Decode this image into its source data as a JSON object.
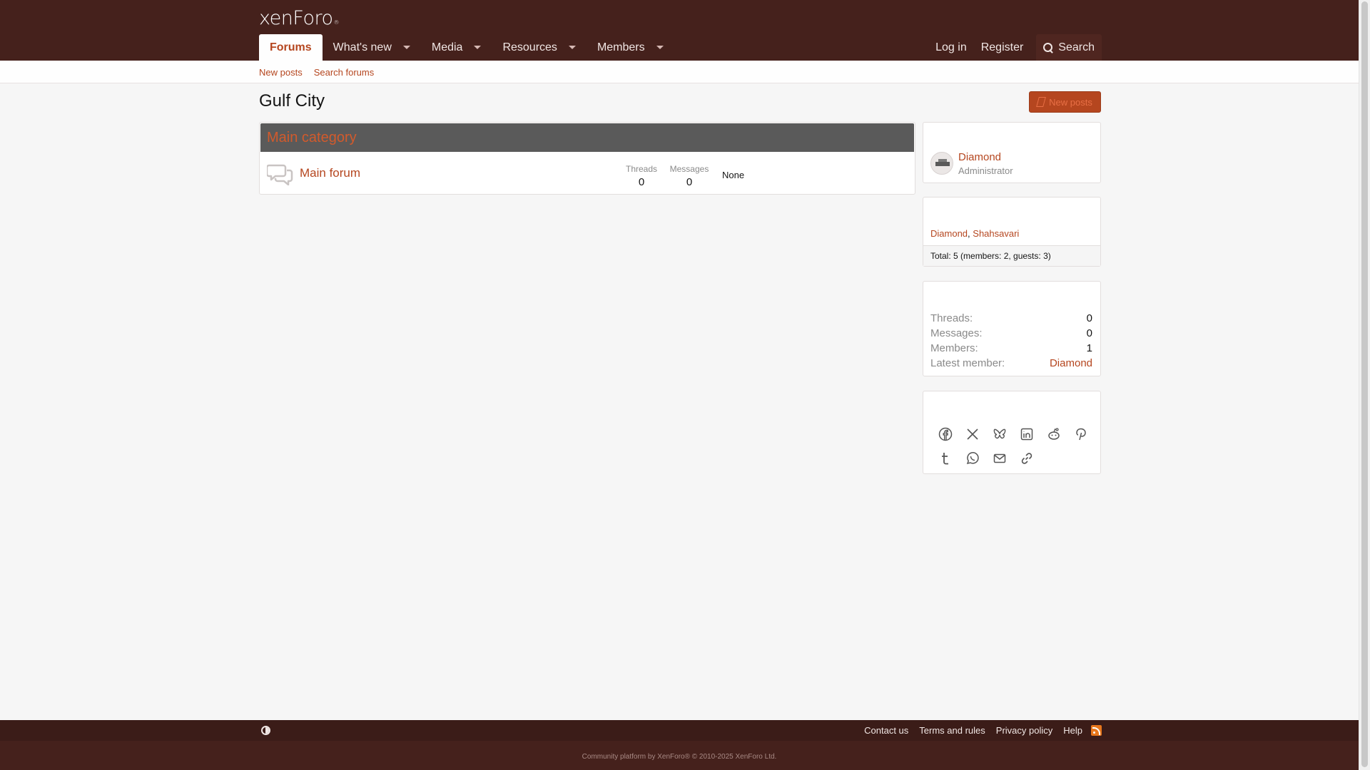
{
  "header": {
    "logo_text": "xenForo",
    "logo_mark": "®",
    "nav": [
      {
        "label": "Forums",
        "active": true,
        "dropdown": false
      },
      {
        "label": "What's new",
        "active": false,
        "dropdown": true
      },
      {
        "label": "Media",
        "active": false,
        "dropdown": true
      },
      {
        "label": "Resources",
        "active": false,
        "dropdown": true
      },
      {
        "label": "Members",
        "active": false,
        "dropdown": true
      }
    ],
    "login_label": "Log in",
    "register_label": "Register",
    "search_label": "Search"
  },
  "subnav": {
    "new_posts": "New posts",
    "search_forums": "Search forums"
  },
  "page": {
    "title": "Gulf City",
    "new_posts_button": "New posts"
  },
  "category": {
    "title": "Main category",
    "forum": {
      "title": "Main forum",
      "threads_label": "Threads",
      "threads_value": "0",
      "messages_label": "Messages",
      "messages_value": "0",
      "last_post": "None"
    }
  },
  "sidebar": {
    "staff": {
      "name": "Diamond",
      "role": "Administrator"
    },
    "online": {
      "members": [
        "Diamond",
        "Shahsavari"
      ],
      "separator": ",",
      "total": "Total: 5 (members: 2, guests: 3)"
    },
    "stats": [
      {
        "key": "Threads:",
        "value": "0"
      },
      {
        "key": "Messages:",
        "value": "0"
      },
      {
        "key": "Members:",
        "value": "1"
      },
      {
        "key": "Latest member:",
        "value": "Diamond"
      }
    ],
    "share_icons_row1": [
      "facebook-icon",
      "x-icon",
      "bluesky-icon",
      "linkedin-icon",
      "reddit-icon",
      "pinterest-icon"
    ],
    "share_icons_row2": [
      "tumblr-icon",
      "whatsapp-icon",
      "email-icon",
      "link-icon"
    ]
  },
  "footer": {
    "links": [
      "Contact us",
      "Terms and rules",
      "Privacy policy",
      "Help"
    ],
    "copyright": "Community platform by XenForo® © 2010-2025 XenForo Ltd."
  },
  "colors": {
    "header_bg": "#45211c",
    "accent": "#b5461f",
    "category_header": "#5a5a5a"
  }
}
